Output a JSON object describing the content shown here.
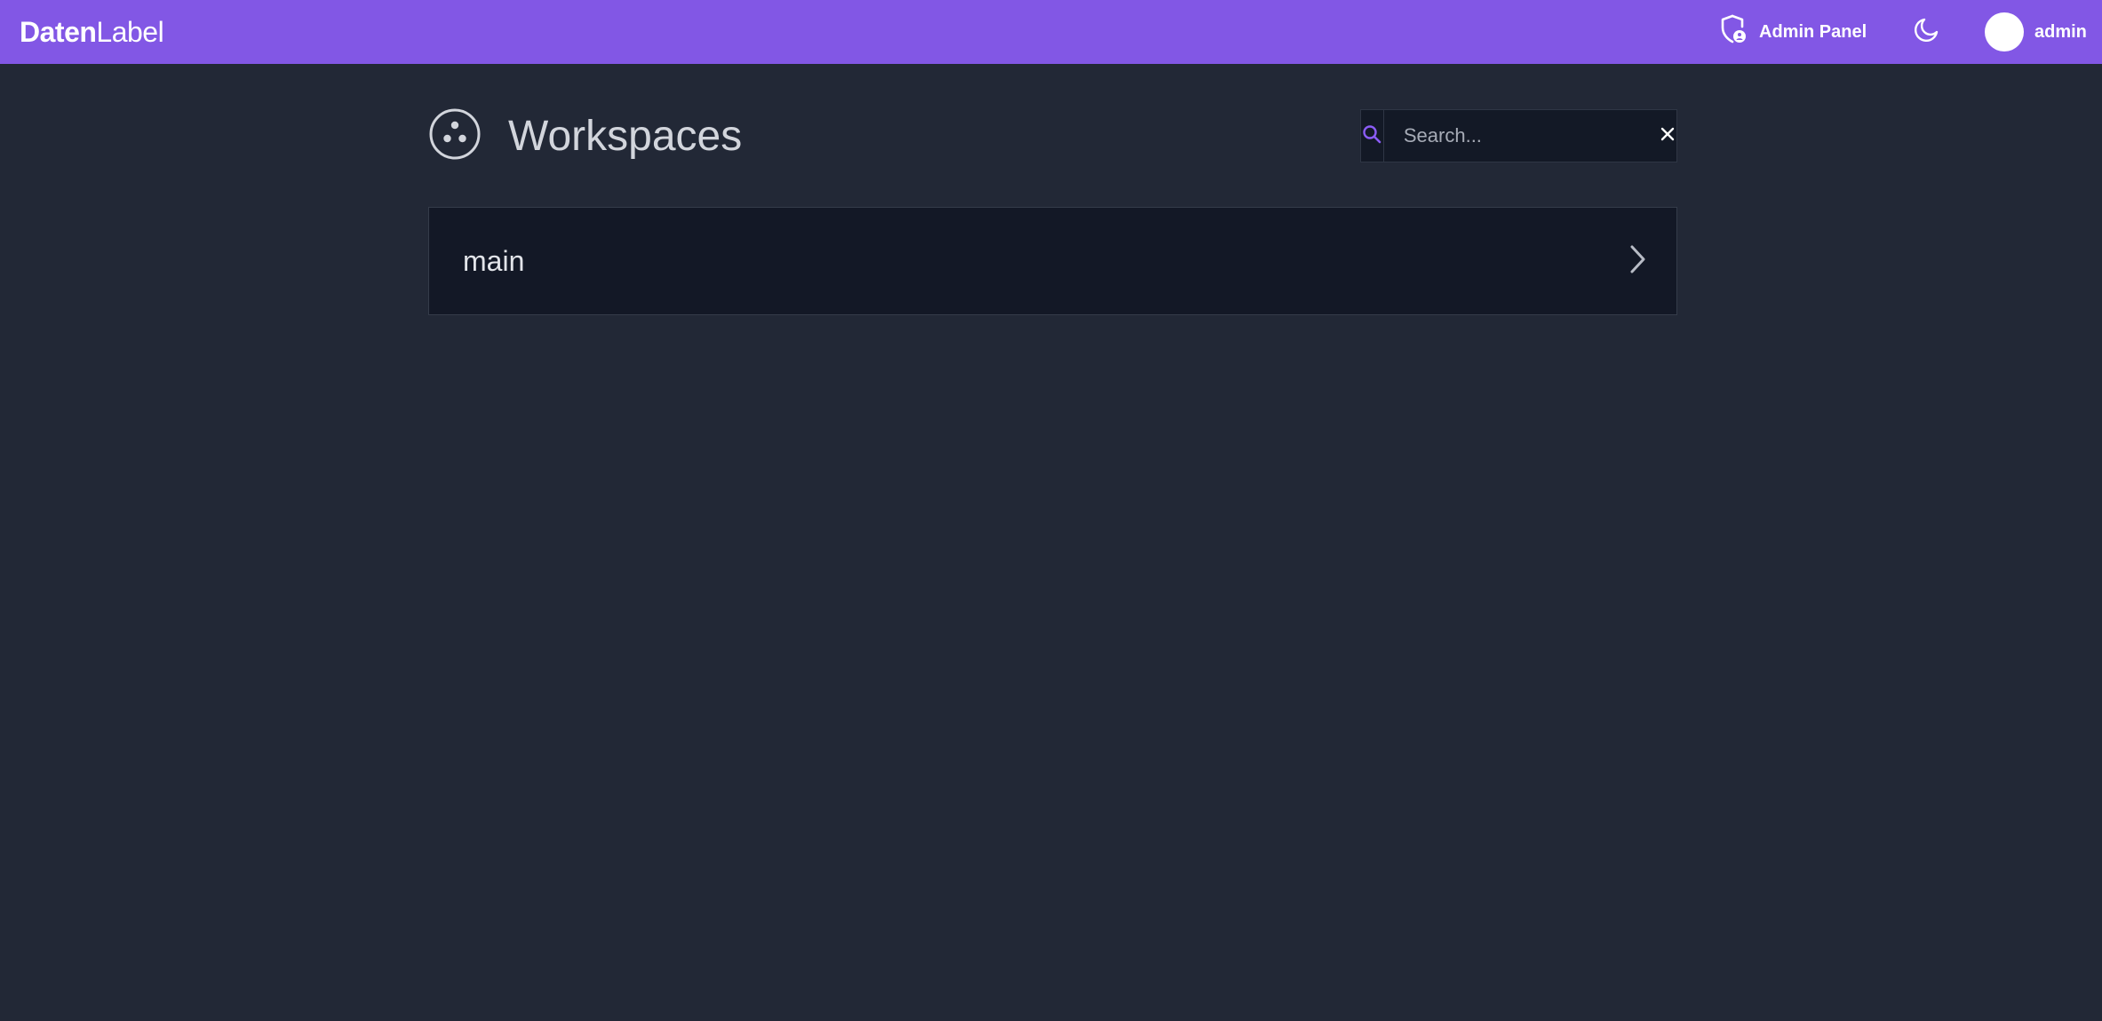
{
  "topbar": {
    "logo_bold": "Daten",
    "logo_light": "Label",
    "admin_panel_label": "Admin Panel",
    "user_name": "admin"
  },
  "page": {
    "title": "Workspaces",
    "icon": "workspaces-icon"
  },
  "search": {
    "placeholder": "Search...",
    "value": ""
  },
  "workspaces": [
    {
      "name": "main"
    }
  ],
  "colors": {
    "accent": "#8257e5",
    "background": "#222836",
    "panel": "#131826"
  }
}
